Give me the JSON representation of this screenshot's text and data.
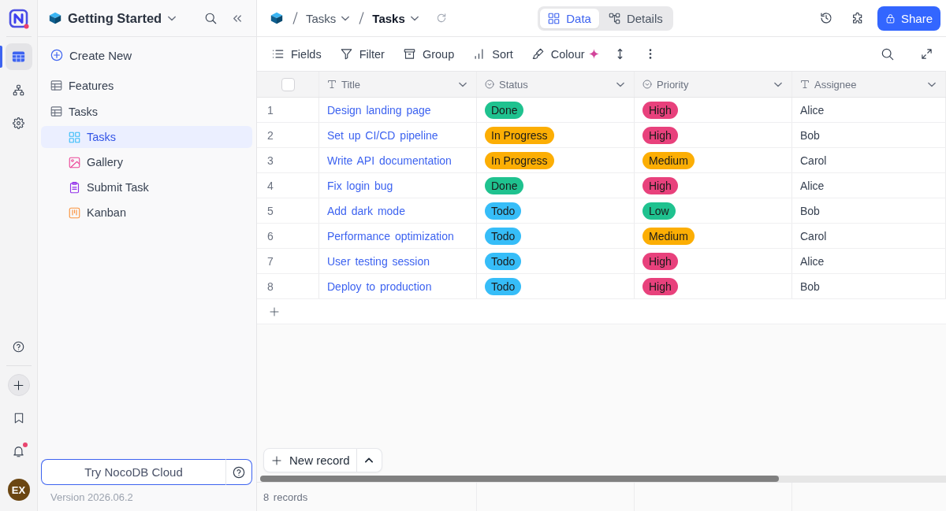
{
  "rail": {
    "items": [
      {
        "kind": "tables",
        "selected": true
      },
      {
        "kind": "hierarchy",
        "selected": false
      },
      {
        "kind": "settings",
        "selected": false
      }
    ],
    "notifications_unread": true,
    "avatar_initials": "EX"
  },
  "sidebar": {
    "base_title": "Getting Started",
    "create_new": "Create New",
    "tables": [
      {
        "label": "Features",
        "selected": false
      },
      {
        "label": "Tasks",
        "selected": false,
        "children": [
          {
            "label": "Tasks",
            "kind": "grid",
            "selected": true
          },
          {
            "label": "Gallery",
            "kind": "gallery",
            "selected": false
          },
          {
            "label": "Submit Task",
            "kind": "form",
            "selected": false
          },
          {
            "label": "Kanban",
            "kind": "kanban",
            "selected": false
          }
        ]
      }
    ],
    "cloud_button": "Try NocoDB Cloud",
    "version": "Version 2026.06.2"
  },
  "topbar": {
    "breadcrumb": [
      {
        "label": "Tasks",
        "current": false
      },
      {
        "label": "Tasks",
        "current": true
      }
    ],
    "view_tabs": [
      {
        "label": "Data",
        "kind": "data",
        "selected": true
      },
      {
        "label": "Details",
        "kind": "details",
        "selected": false
      }
    ],
    "share_button": "Share"
  },
  "toolbar": {
    "items": [
      {
        "label": "Fields",
        "kind": "fields"
      },
      {
        "label": "Filter",
        "kind": "filter"
      },
      {
        "label": "Group",
        "kind": "group"
      },
      {
        "label": "Sort",
        "kind": "sort"
      },
      {
        "label": "Colour",
        "kind": "colour"
      }
    ]
  },
  "grid": {
    "select_all": {
      "checked": false
    },
    "columns": [
      {
        "label": "Title",
        "kind": "text",
        "primary": true
      },
      {
        "label": "Status",
        "kind": "select",
        "primary": false
      },
      {
        "label": "Priority",
        "kind": "select",
        "primary": false
      },
      {
        "label": "Assignee",
        "kind": "text",
        "primary": false
      }
    ],
    "rows": [
      {
        "number": "1",
        "cells": [
          "Design landing page",
          {
            "label": "Done",
            "color": "#1fc28f"
          },
          {
            "label": "High",
            "color": "#e8417c"
          },
          "Alice"
        ]
      },
      {
        "number": "2",
        "cells": [
          "Set up CI/CD pipeline",
          {
            "label": "In Progress",
            "color": "#fcae04"
          },
          {
            "label": "High",
            "color": "#e8417c"
          },
          "Bob"
        ]
      },
      {
        "number": "3",
        "cells": [
          "Write API documentation",
          {
            "label": "In Progress",
            "color": "#fcae04"
          },
          {
            "label": "Medium",
            "color": "#fcae04"
          },
          "Carol"
        ]
      },
      {
        "number": "4",
        "cells": [
          "Fix login bug",
          {
            "label": "Done",
            "color": "#1fc28f"
          },
          {
            "label": "High",
            "color": "#e8417c"
          },
          "Alice"
        ]
      },
      {
        "number": "5",
        "cells": [
          "Add dark mode",
          {
            "label": "Todo",
            "color": "#36bdf8"
          },
          {
            "label": "Low",
            "color": "#1fc28f"
          },
          "Bob"
        ]
      },
      {
        "number": "6",
        "cells": [
          "Performance optimization",
          {
            "label": "Todo",
            "color": "#36bdf8"
          },
          {
            "label": "Medium",
            "color": "#fcae04"
          },
          "Carol"
        ]
      },
      {
        "number": "7",
        "cells": [
          "User testing session",
          {
            "label": "Todo",
            "color": "#36bdf8"
          },
          {
            "label": "High",
            "color": "#e8417c"
          },
          "Alice"
        ]
      },
      {
        "number": "8",
        "cells": [
          "Deploy to production",
          {
            "label": "Todo",
            "color": "#36bdf8"
          },
          {
            "label": "High",
            "color": "#e8417c"
          },
          "Bob"
        ]
      }
    ],
    "new_record_button": "New record",
    "record_count": "8 records"
  }
}
